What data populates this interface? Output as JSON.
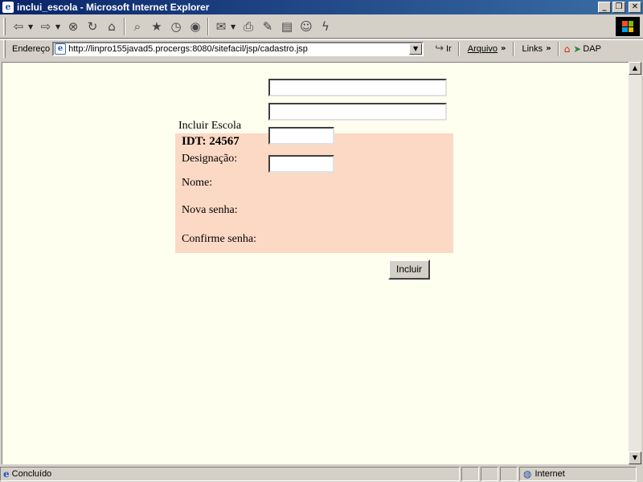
{
  "window": {
    "title": "inclui_escola - Microsoft Internet Explorer",
    "controls": {
      "minimize": "_",
      "maximize": "❐",
      "close": "✕"
    }
  },
  "toolbar": {
    "icons": [
      "back-icon",
      "forward-icon",
      "stop-icon",
      "refresh-icon",
      "home-icon",
      "search-icon",
      "favorites-icon",
      "history-icon",
      "channels-icon",
      "mail-icon",
      "print-icon",
      "edit-icon",
      "discuss-icon",
      "messenger-icon",
      "lightning-icon"
    ],
    "glyphs": {
      "back": "⇦",
      "forward": "⇨",
      "stop": "⊗",
      "refresh": "↻",
      "home": "⌂",
      "search": "⌕",
      "favorites": "★",
      "history": "◷",
      "channels": "◉",
      "mail": "✉",
      "print": "⎙",
      "edit": "✎",
      "discuss": "▤",
      "messenger": "☺",
      "lightning": "ϟ"
    }
  },
  "address": {
    "label": "Endereço",
    "url": "http://linpro155javad5.procergs:8080/sitefacil/jsp/cadastro.jsp",
    "go_label": "Ir",
    "menu_arquivo": "Arquivo",
    "links_label": "Links",
    "dap_label": "DAP"
  },
  "form": {
    "caption": "Incluir Escola",
    "idt": "IDT: 24567",
    "fields": [
      {
        "label": "Designação:",
        "value": ""
      },
      {
        "label": "Nome:",
        "value": ""
      },
      {
        "label": "Nova senha:",
        "value": ""
      },
      {
        "label": "Confirme senha:",
        "value": ""
      }
    ],
    "submit_label": "Incluir"
  },
  "status": {
    "text": "Concluído",
    "zone": "Internet"
  }
}
